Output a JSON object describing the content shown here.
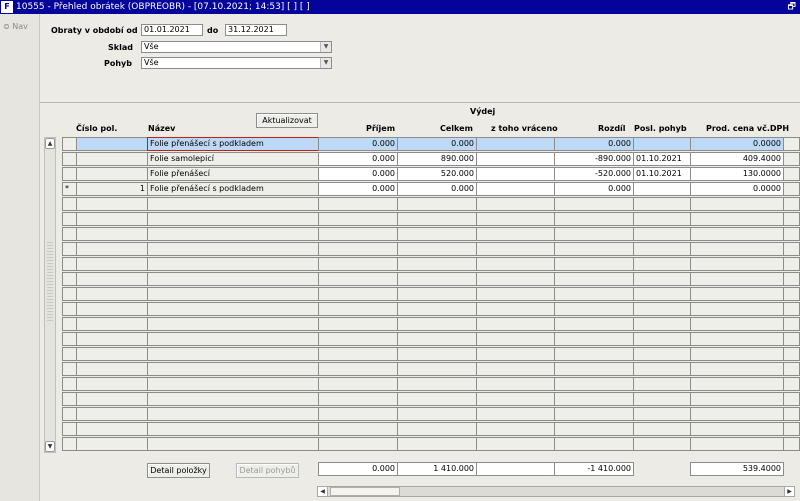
{
  "window": {
    "title": "10555 - Přehled obrátek (OBPREOBR) - [07.10.2021; 14:53]  [ ]  [ ]",
    "logo_text": "F",
    "restore_glyph": "🗗"
  },
  "nav": {
    "label": "Nav",
    "icon": "nav-icon"
  },
  "filters": {
    "period_label": "Obraty v období od",
    "date_from": "01.01.2021",
    "to_label": "do",
    "date_to": "31.12.2021",
    "warehouse_label": "Sklad",
    "warehouse_value": "Vše",
    "movement_label": "Pohyb",
    "movement_value": "Vše"
  },
  "table": {
    "group_header": "Výdej",
    "refresh_button": "Aktualizovat",
    "columns": {
      "item_no": "Číslo pol.",
      "name": "Název",
      "receipt": "Příjem",
      "total": "Celkem",
      "returned": "z toho vráceno",
      "difference": "Rozdíl",
      "last_move": "Posl. pohyb",
      "price": "Prod. cena vč.DPH"
    },
    "rows": [
      {
        "marker": "",
        "item_no": "",
        "name": "Folie přenášecí s podkladem",
        "receipt": "0.000",
        "total": "0.000",
        "returned": "",
        "difference": "0.000",
        "last_move": "",
        "price": "0.0000"
      },
      {
        "marker": "",
        "item_no": "",
        "name": "Folie samolepicí",
        "receipt": "0.000",
        "total": "890.000",
        "returned": "",
        "difference": "-890.000",
        "last_move": "01.10.2021",
        "price": "409.4000"
      },
      {
        "marker": "",
        "item_no": "",
        "name": "Folie přenášecí",
        "receipt": "0.000",
        "total": "520.000",
        "returned": "",
        "difference": "-520.000",
        "last_move": "01.10.2021",
        "price": "130.0000"
      },
      {
        "marker": "*",
        "item_no": "1",
        "name": "Folie přenášecí s podkladem",
        "receipt": "0.000",
        "total": "0.000",
        "returned": "",
        "difference": "0.000",
        "last_move": "",
        "price": "0.0000"
      }
    ],
    "empty_rows": 17
  },
  "footer": {
    "detail_item_button": "Detail položky",
    "detail_moves_button": "Detail pohybů",
    "sum_receipt": "0.000",
    "sum_total": "1 410.000",
    "sum_returned": "",
    "sum_difference": "-1 410.000",
    "sum_price": "539.4000"
  },
  "colors": {
    "titlebar": "#04049a",
    "selected_row": "#bdd9f6",
    "focus_border": "#c21c1c"
  }
}
